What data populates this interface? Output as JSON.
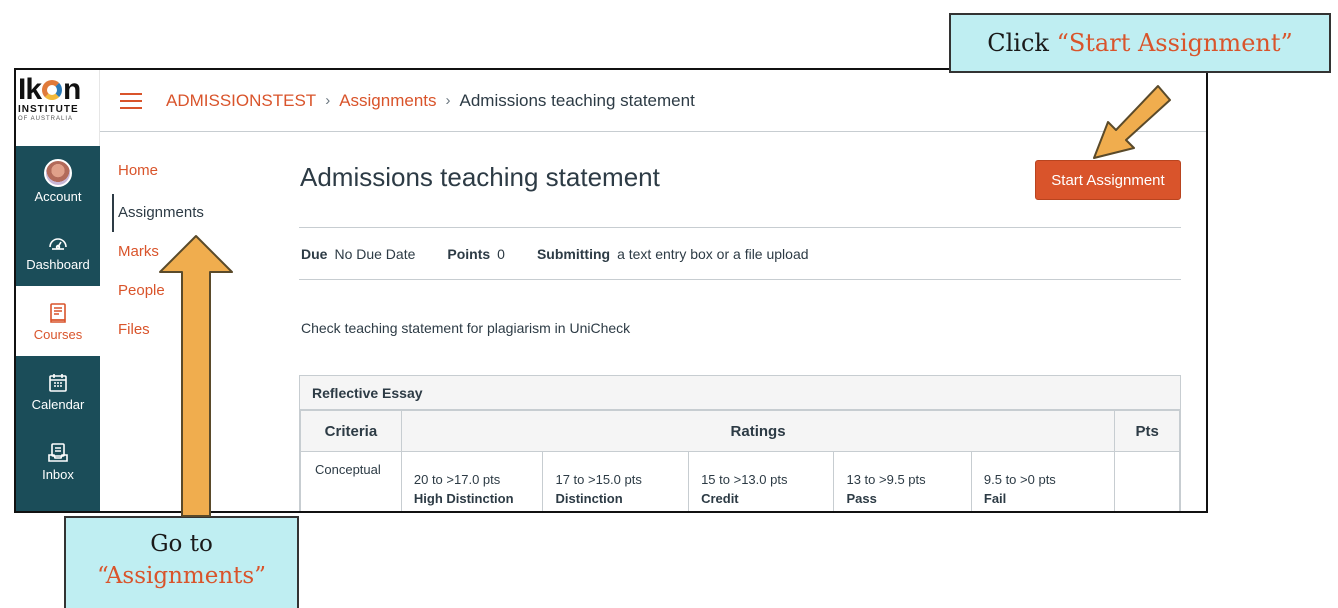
{
  "global_nav": {
    "logo": {
      "word": "Ikon",
      "line1": "INSTITUTE",
      "line2": "OF AUSTRALIA"
    },
    "items": [
      {
        "label": "Account",
        "icon": "avatar-icon"
      },
      {
        "label": "Dashboard",
        "icon": "dashboard-icon"
      },
      {
        "label": "Courses",
        "icon": "courses-icon",
        "active": true
      },
      {
        "label": "Calendar",
        "icon": "calendar-icon"
      },
      {
        "label": "Inbox",
        "icon": "inbox-icon"
      },
      {
        "label": "",
        "icon": "history-clock-icon"
      }
    ]
  },
  "header": {
    "breadcrumb": [
      "ADMISSIONSTEST",
      "Assignments",
      "Admissions teaching statement"
    ],
    "separator": "›"
  },
  "course_nav": {
    "items": [
      "Home",
      "Assignments",
      "Marks",
      "People",
      "Files"
    ],
    "active": "Assignments"
  },
  "assignment": {
    "title": "Admissions teaching statement",
    "start_button": "Start Assignment",
    "due_label": "Due",
    "due_value": "No Due Date",
    "points_label": "Points",
    "points_value": "0",
    "submitting_label": "Submitting",
    "submitting_value": "a text entry box or a file upload",
    "description": "Check teaching statement for plagiarism in UniCheck"
  },
  "rubric": {
    "title": "Reflective Essay",
    "headers": {
      "criteria": "Criteria",
      "ratings": "Ratings",
      "pts": "Pts"
    },
    "rows": [
      {
        "criterion": "Conceptual",
        "ratings": [
          {
            "pts": "20 to >17.0 pts",
            "desc": "High Distinction"
          },
          {
            "pts": "17 to >15.0 pts",
            "desc": "Distinction"
          },
          {
            "pts": "15 to >13.0 pts",
            "desc": "Credit"
          },
          {
            "pts": "13 to >9.5 pts",
            "desc": "Pass"
          },
          {
            "pts": "9.5 to >0 pts",
            "desc": "Fail"
          }
        ],
        "pts": ""
      }
    ]
  },
  "callouts": {
    "top": {
      "prefix": "Click ",
      "highlight": "“Start Assignment”"
    },
    "bottom": {
      "prefix": "Go to",
      "highlight": "“Assignments”"
    }
  },
  "colors": {
    "accent": "#d9542b",
    "nav_bg": "#1b4d59",
    "callout_bg": "#bfeef2",
    "arrow": "#f0ad4e"
  }
}
